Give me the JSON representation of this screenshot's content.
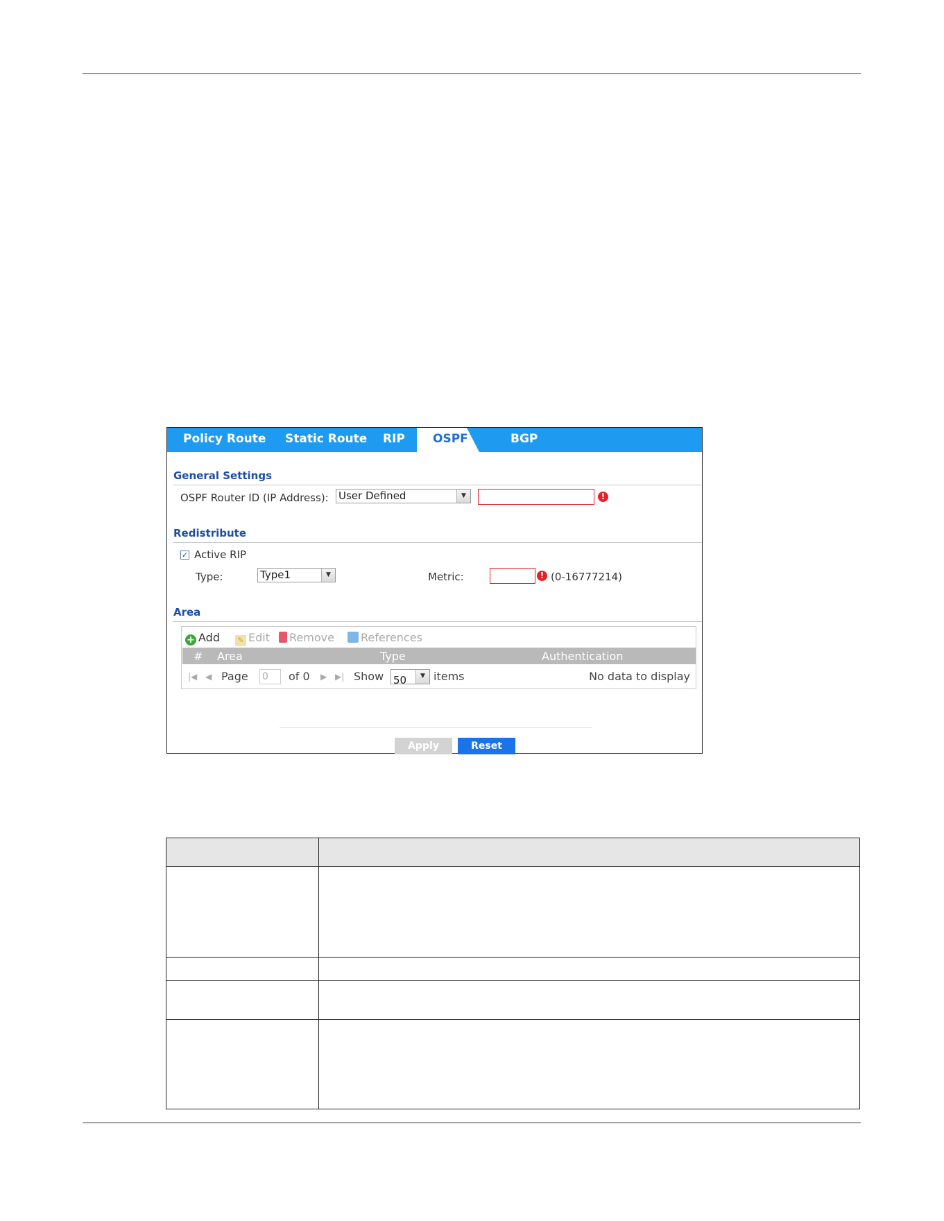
{
  "tabs": [
    {
      "label": "Policy Route",
      "active": false
    },
    {
      "label": "Static Route",
      "active": false
    },
    {
      "label": "RIP",
      "active": false
    },
    {
      "label": "OSPF",
      "active": true
    },
    {
      "label": "BGP",
      "active": false
    }
  ],
  "general_settings": {
    "title": "General Settings",
    "router_id_label": "OSPF Router ID (IP Address):",
    "router_id_select": "User Defined",
    "router_id_value": "",
    "error_icon": "!"
  },
  "redistribute": {
    "title": "Redistribute",
    "active_rip_label": "Active RIP",
    "active_rip_checked": "✓",
    "type_label": "Type:",
    "type_select": "Type1",
    "metric_label": "Metric:",
    "metric_value": "",
    "metric_range": "(0-16777214)"
  },
  "area": {
    "title": "Area",
    "toolbar": {
      "add": "Add",
      "edit": "Edit",
      "remove": "Remove",
      "references": "References"
    },
    "columns": [
      "#",
      "Area",
      "Type",
      "Authentication"
    ],
    "pager": {
      "page_label": "Page",
      "page_value": "0",
      "of_label": "of 0",
      "show_label": "Show",
      "show_value": "50",
      "items_label": "items",
      "empty_message": "No data to display"
    }
  },
  "buttons": {
    "apply": "Apply",
    "reset": "Reset"
  },
  "colors": {
    "tab_bar": "#1e9bf0",
    "section_title": "#1d4fa5",
    "reset_button": "#1a73e8",
    "error": "#e42228"
  }
}
